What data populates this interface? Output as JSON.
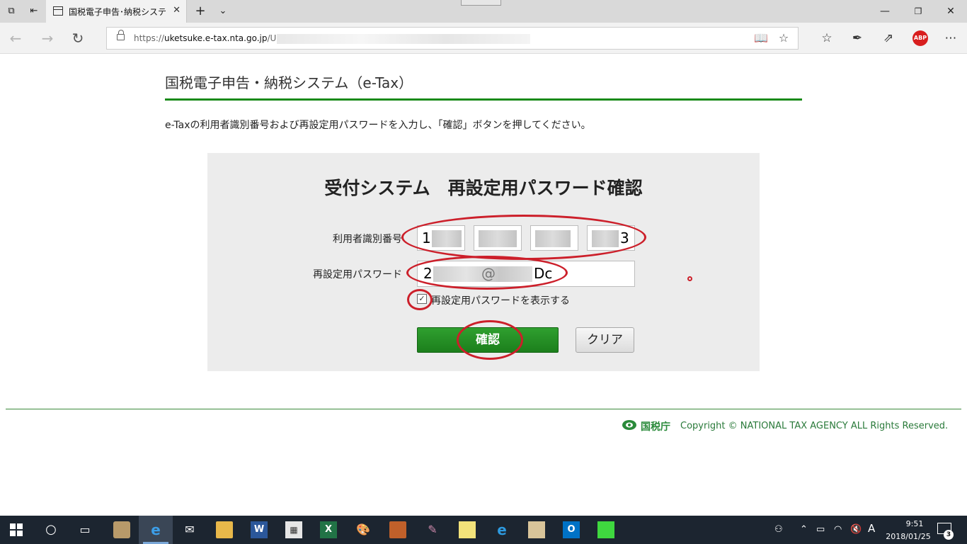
{
  "browser": {
    "tab_title": "国税電子申告･納税システ",
    "url_prefix": "https://",
    "url_domain": "uketsuke.e-tax.nta.go.jp",
    "url_path": "/UF_"
  },
  "page": {
    "heading": "国税電子申告・納税システム（e-Tax）",
    "instruction": "e-Taxの利用者識別番号および再設定用パスワードを入力し、「確認」ボタンを押してください。"
  },
  "form": {
    "title": "受付システム　再設定用パスワード確認",
    "user_id_label": "利用者識別番号",
    "user_id_parts": [
      "1",
      "",
      "",
      "3"
    ],
    "password_label": "再設定用パスワード",
    "password_visible_start": "2",
    "password_visible_mid": "@",
    "password_visible_end": "Dc",
    "show_password_label": "再設定用パスワードを表示する",
    "show_password_checked": true,
    "confirm_button": "確認",
    "clear_button": "クリア"
  },
  "footer": {
    "agency_name": "国税庁",
    "copyright": "Copyright © NATIONAL TAX AGENCY ALL Rights Reserved."
  },
  "taskbar": {
    "time": "9:51",
    "date": "2018/01/25",
    "ime": "A",
    "notification_count": "3"
  },
  "colors": {
    "accent_green": "#1a8a1a",
    "annotation_red": "#cc1f2a"
  }
}
